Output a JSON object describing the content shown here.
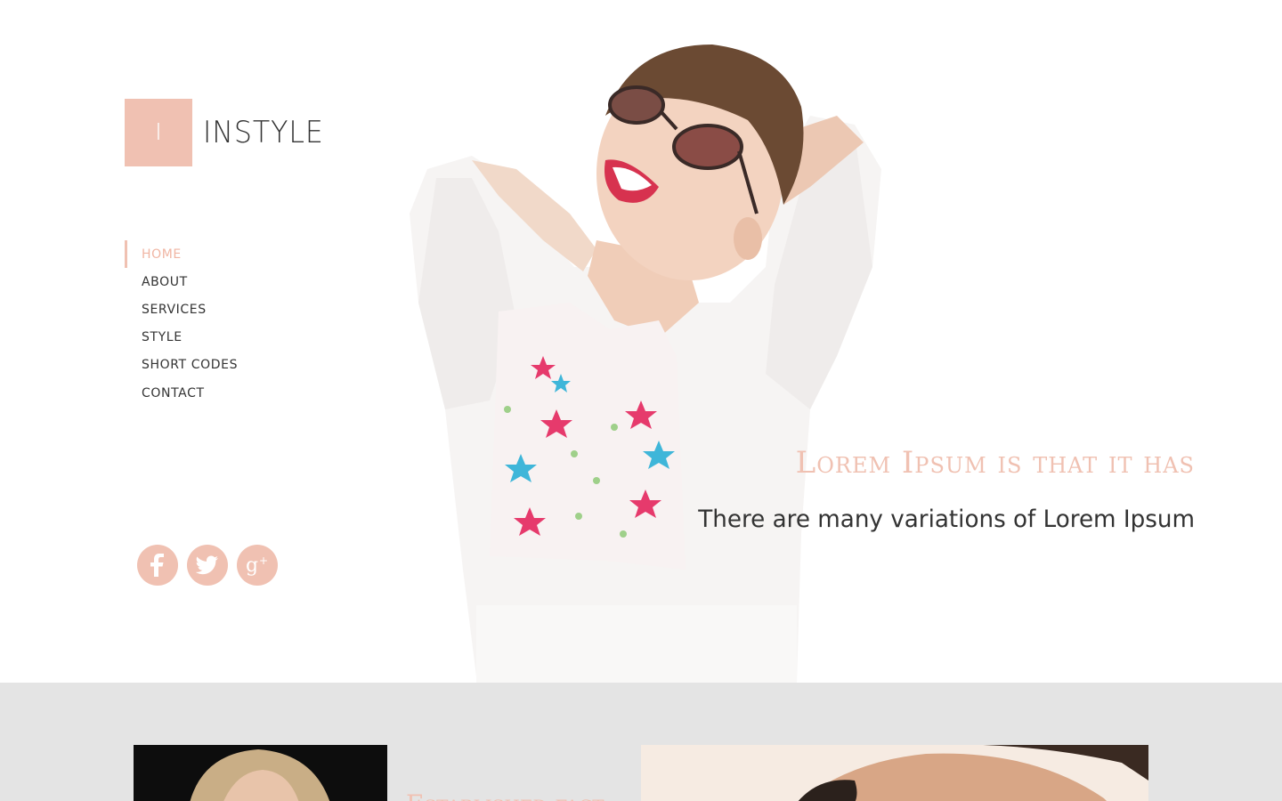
{
  "brand": {
    "logo_letter": "I",
    "name": "INSTYLE",
    "accent_color": "#f0c1b2"
  },
  "nav": {
    "items": [
      {
        "label": "HOME",
        "active": true
      },
      {
        "label": "ABOUT"
      },
      {
        "label": "SERVICES"
      },
      {
        "label": "STYLE"
      },
      {
        "label": "SHORT CODES"
      },
      {
        "label": "CONTACT"
      }
    ]
  },
  "social": {
    "icons": [
      "facebook-icon",
      "twitter-icon",
      "google-plus-icon"
    ]
  },
  "hero": {
    "heading": "Lorem Ipsum is that it has",
    "subheading": "There are many variations of Lorem Ipsum"
  },
  "lower": {
    "heading": "Established fact"
  }
}
